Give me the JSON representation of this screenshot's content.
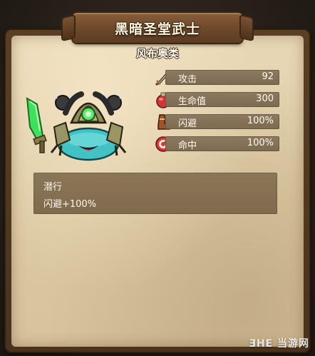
{
  "card": {
    "title": "黑暗圣堂武士",
    "subtitle": "风布奥类"
  },
  "stats": [
    {
      "label": "攻击",
      "value": "92",
      "icon": "sword-icon"
    },
    {
      "label": "生命值",
      "value": "300",
      "icon": "health-potion-icon"
    },
    {
      "label": "闪避",
      "value": "100%",
      "icon": "boot-icon"
    },
    {
      "label": "命中",
      "value": "100%",
      "icon": "target-icon"
    }
  ],
  "skill": {
    "name": "潜行",
    "description": "闪避+100%"
  },
  "watermark": {
    "text": "ƎHE 当游网",
    "logo": "watermark-logo"
  },
  "colors": {
    "parchment": "#e2d1ad",
    "stat_bar": "#857157",
    "frame": "#5a3f26",
    "title_board": "#7a522f",
    "hero_blade": "#39d050",
    "hero_slime": "#3fb6b8"
  }
}
